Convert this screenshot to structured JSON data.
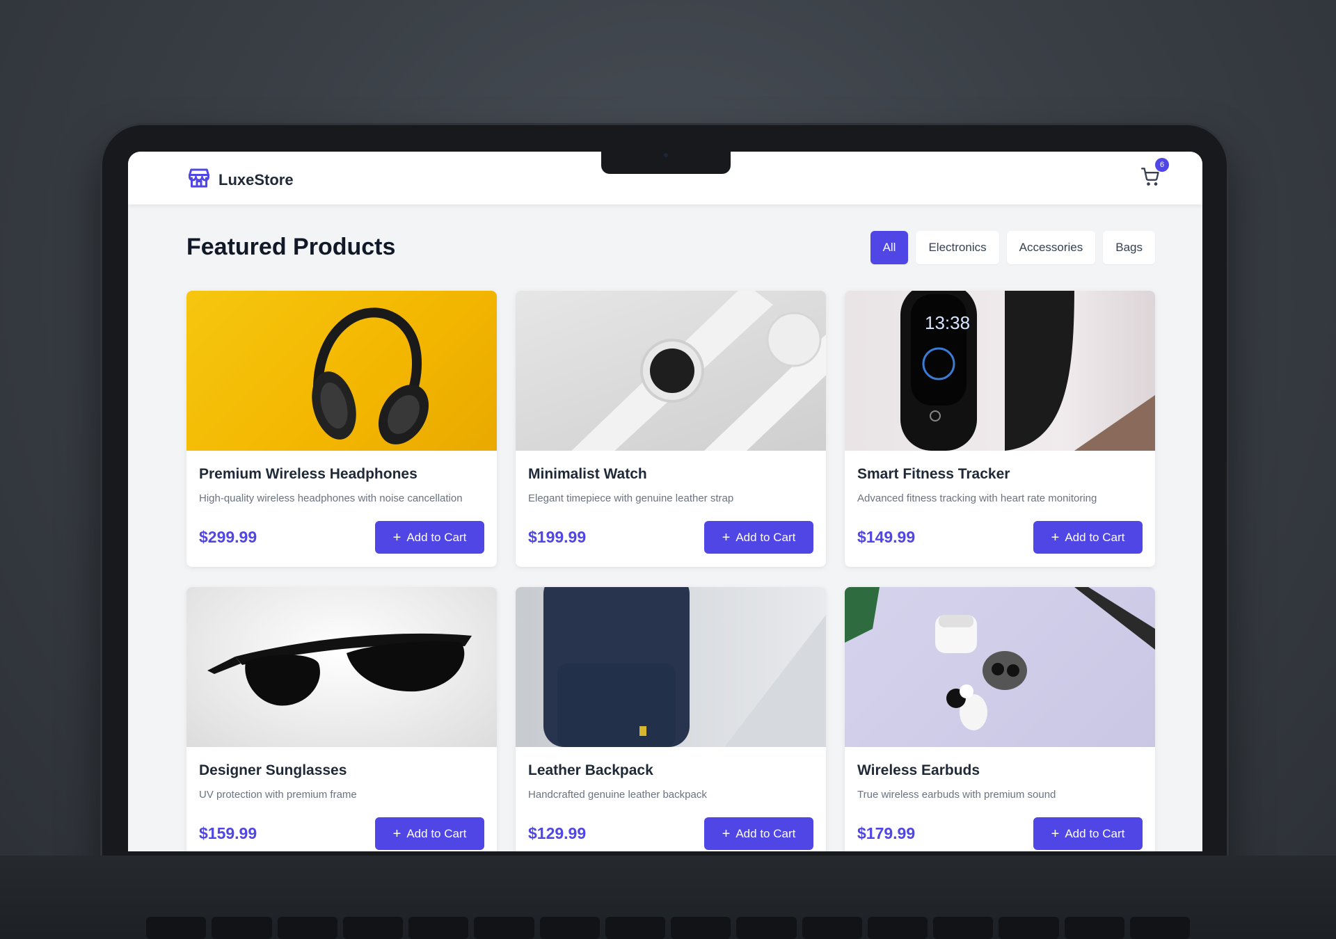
{
  "app": {
    "brand": "LuxeStore",
    "cart_count": "6"
  },
  "page": {
    "title": "Featured Products"
  },
  "filters": [
    {
      "label": "All",
      "active": true
    },
    {
      "label": "Electronics",
      "active": false
    },
    {
      "label": "Accessories",
      "active": false
    },
    {
      "label": "Bags",
      "active": false
    }
  ],
  "products": [
    {
      "name": "Premium Wireless Headphones",
      "description": "High-quality wireless headphones with noise cancellation",
      "price": "$299.99",
      "button": "Add to Cart",
      "image": "headphones"
    },
    {
      "name": "Minimalist Watch",
      "description": "Elegant timepiece with genuine leather strap",
      "price": "$199.99",
      "button": "Add to Cart",
      "image": "watch"
    },
    {
      "name": "Smart Fitness Tracker",
      "description": "Advanced fitness tracking with heart rate monitoring",
      "price": "$149.99",
      "button": "Add to Cart",
      "image": "tracker"
    },
    {
      "name": "Designer Sunglasses",
      "description": "UV protection with premium frame",
      "price": "$159.99",
      "button": "Add to Cart",
      "image": "sunglasses"
    },
    {
      "name": "Leather Backpack",
      "description": "Handcrafted genuine leather backpack",
      "price": "$129.99",
      "button": "Add to Cart",
      "image": "backpack"
    },
    {
      "name": "Wireless Earbuds",
      "description": "True wireless earbuds with premium sound",
      "price": "$179.99",
      "button": "Add to Cart",
      "image": "earbuds"
    }
  ],
  "tracker_display": {
    "time": "13:38"
  },
  "colors": {
    "accent": "#4f46e5",
    "background": "#f3f4f6",
    "frame": "#17191d"
  }
}
